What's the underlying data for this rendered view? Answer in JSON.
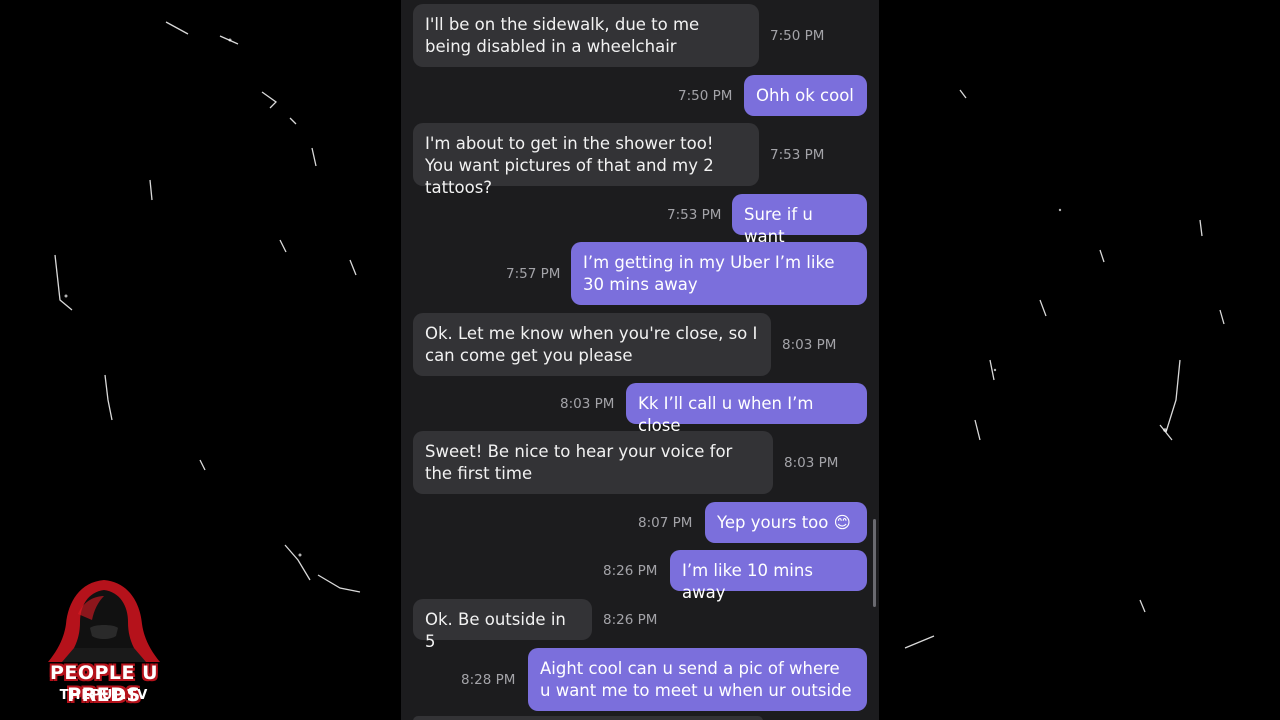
{
  "messages": [
    {
      "dir": "in",
      "text": "I'll be on the sidewalk, due to me being disabled in a wheelchair",
      "time": "7:50 PM"
    },
    {
      "dir": "out",
      "text": "Ohh ok cool",
      "time": "7:50 PM"
    },
    {
      "dir": "in",
      "text": "I'm about to get in the shower too!  You want pictures of that and my 2 tattoos?",
      "time": "7:53 PM"
    },
    {
      "dir": "out",
      "text": "Sure if u want",
      "time": "7:53 PM"
    },
    {
      "dir": "out",
      "text": "I’m getting in my Uber I’m like 30 mins away",
      "time": "7:57 PM"
    },
    {
      "dir": "in",
      "text": "Ok.  Let me know when you're close, so I can come get you please",
      "time": "8:03 PM"
    },
    {
      "dir": "out",
      "text": "Kk I’ll call u when I’m close",
      "time": "8:03 PM"
    },
    {
      "dir": "in",
      "text": "Sweet!  Be nice to hear your voice for the first time",
      "time": "8:03 PM"
    },
    {
      "dir": "out",
      "text": "Yep yours too 😊",
      "time": "8:07 PM"
    },
    {
      "dir": "out",
      "text": "I’m like 10 mins away",
      "time": "8:26 PM"
    },
    {
      "dir": "in",
      "text": "Ok.  Be outside in 5",
      "time": "8:26 PM"
    },
    {
      "dir": "out",
      "text": "Aight cool can u send a pic of where u want me to meet u when ur outside",
      "time": "8:28 PM"
    }
  ],
  "logo": {
    "title": "PEOPLE U PREDS",
    "subtitle": "THEPUP.TV",
    "icon": "hooded-figure-icon"
  },
  "colors": {
    "incoming_bubble": "#333336",
    "outgoing_bubble": "#7b6fdc",
    "panel": "#1c1c1e",
    "timestamp": "#a3a3a8",
    "logo_red": "#b5121b"
  }
}
